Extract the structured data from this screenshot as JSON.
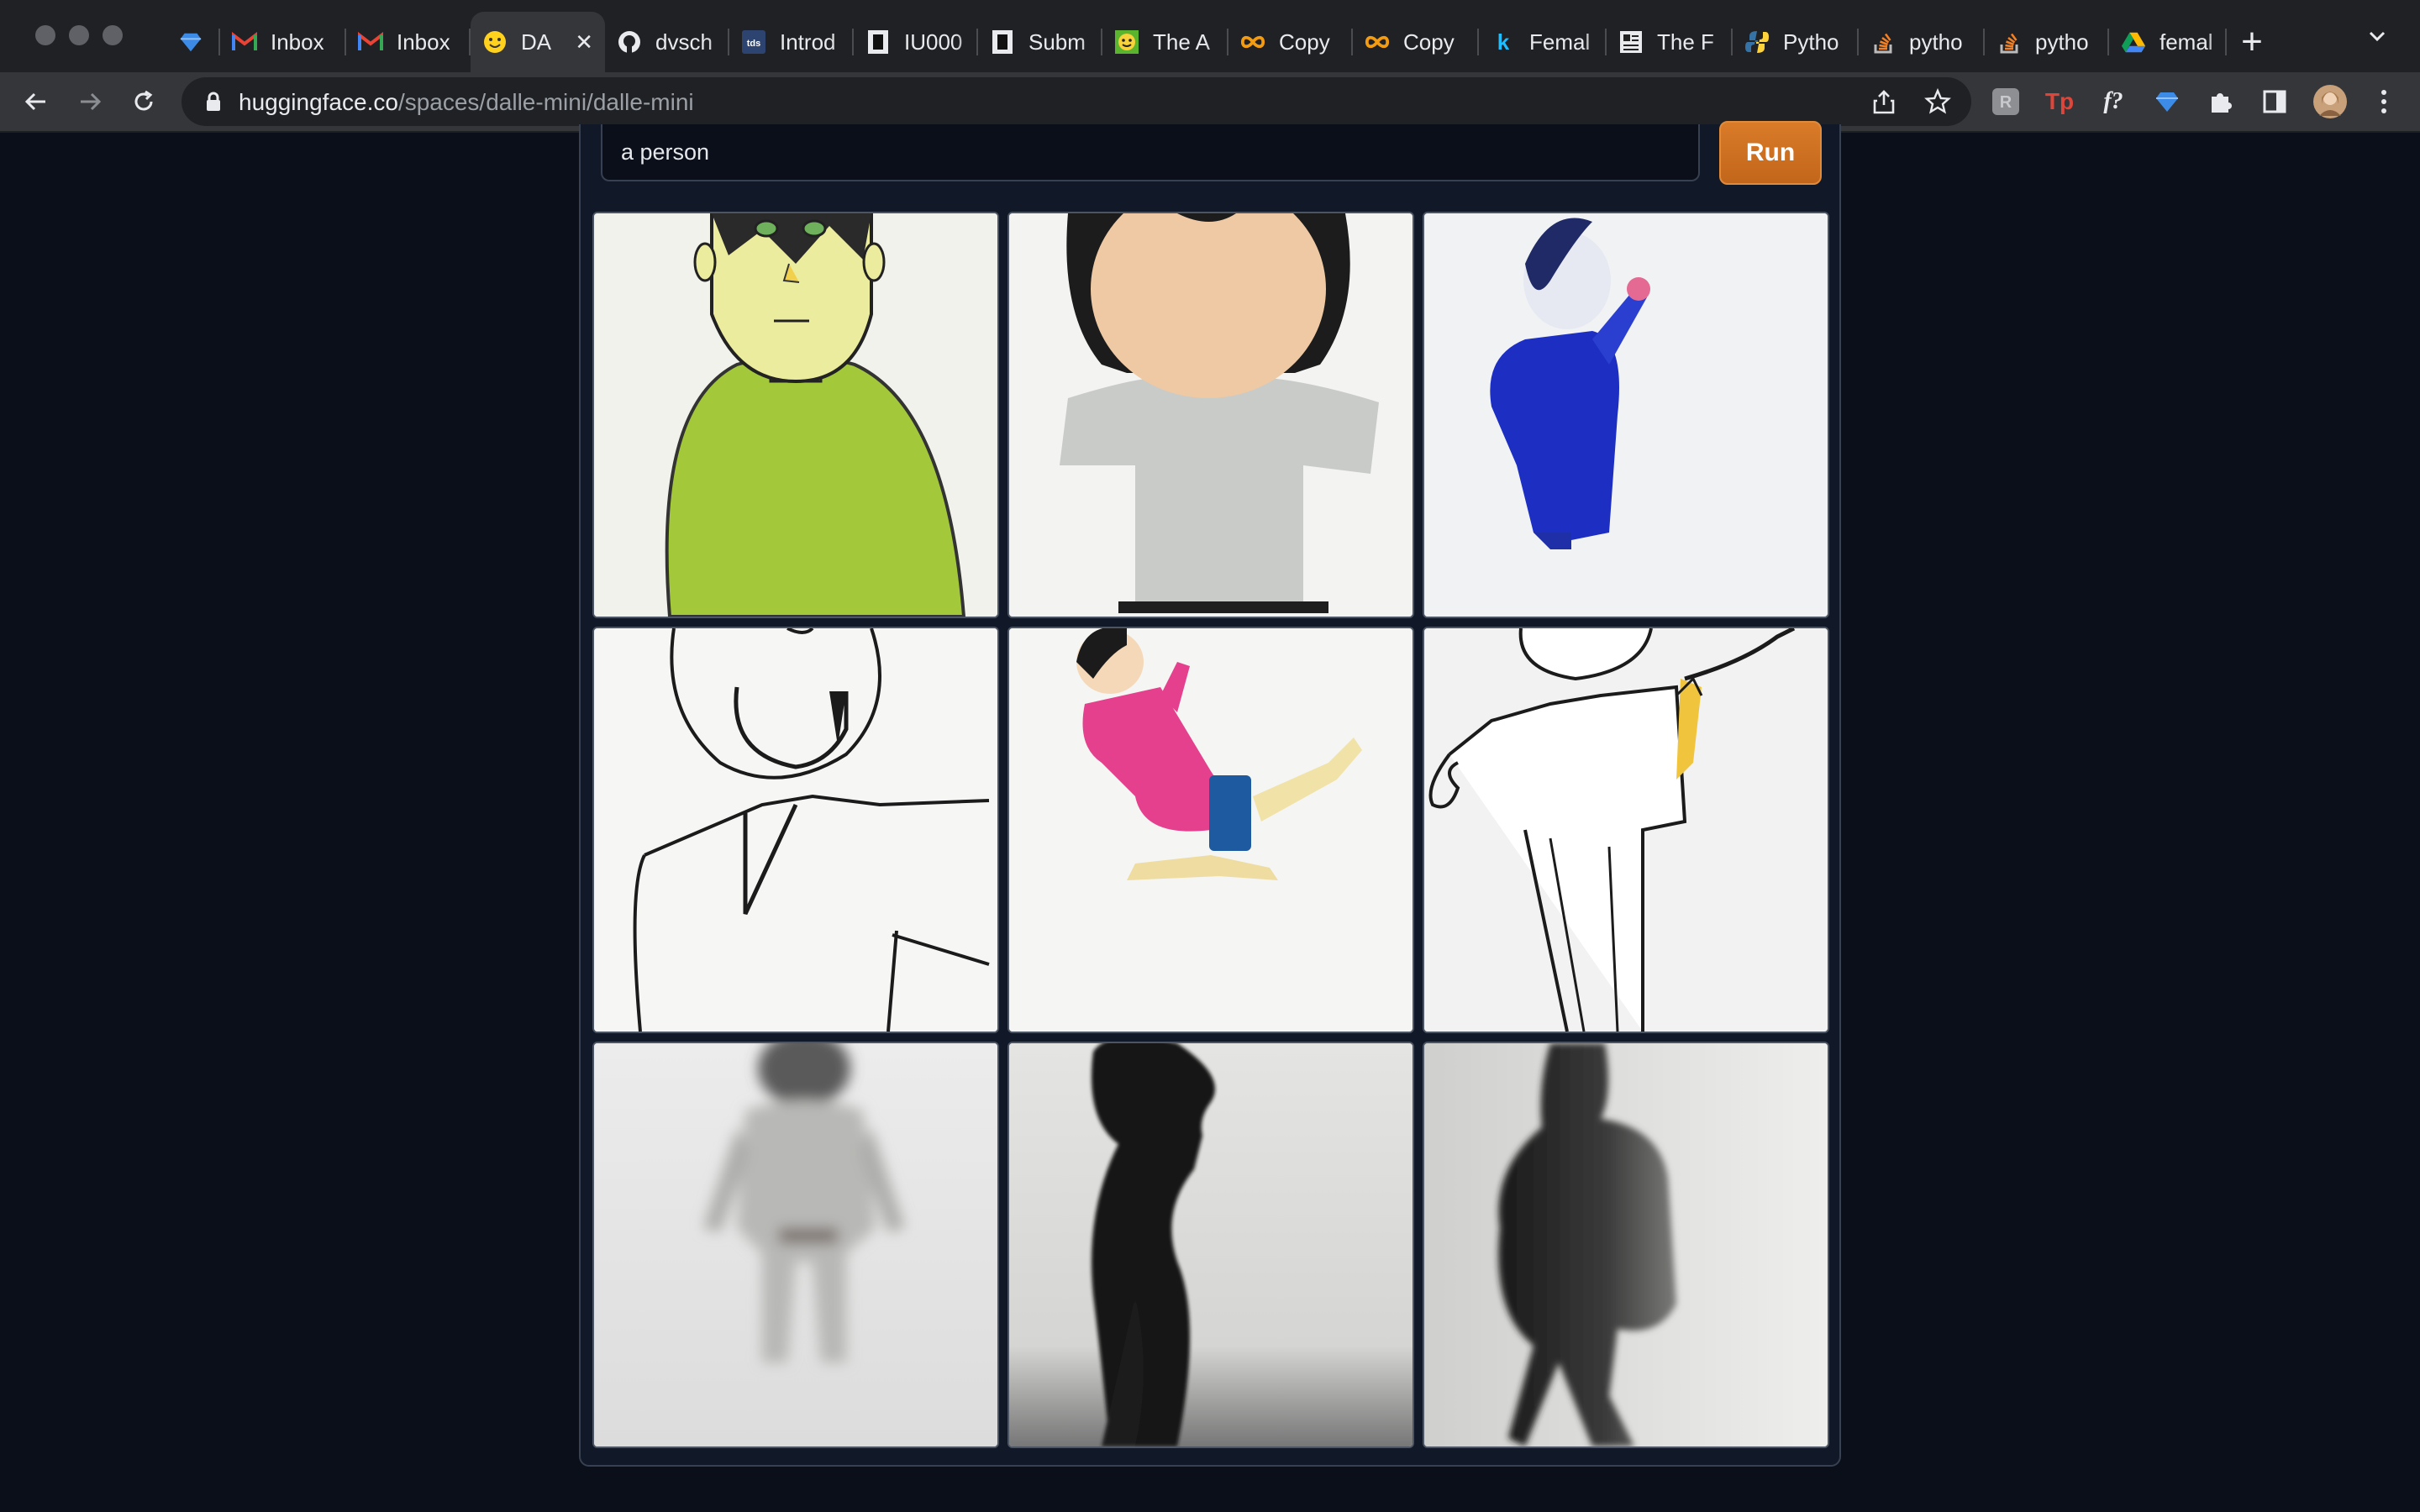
{
  "browser": {
    "tabs": [
      {
        "label": "",
        "icon": "gem-icon",
        "pinned": true
      },
      {
        "label": "Inbox",
        "icon": "gmail-icon"
      },
      {
        "label": "Inbox",
        "icon": "gmail-icon"
      },
      {
        "label": "DA",
        "icon": "hugging-face-icon",
        "active": true
      },
      {
        "label": "dvsch",
        "icon": "github-icon"
      },
      {
        "label": "Introd",
        "icon": "tds-icon"
      },
      {
        "label": "IU000",
        "icon": "notion-icon"
      },
      {
        "label": "Subm",
        "icon": "notion-icon"
      },
      {
        "label": "The A",
        "icon": "smiley-icon"
      },
      {
        "label": "Copy",
        "icon": "infinity-icon"
      },
      {
        "label": "Copy",
        "icon": "infinity-icon"
      },
      {
        "label": "Femal",
        "icon": "kaggle-icon"
      },
      {
        "label": "The F",
        "icon": "document-icon"
      },
      {
        "label": "Pytho",
        "icon": "python-icon"
      },
      {
        "label": "pytho",
        "icon": "stackoverflow-icon"
      },
      {
        "label": "pytho",
        "icon": "stackoverflow-icon"
      },
      {
        "label": "femal",
        "icon": "google-drive-icon"
      }
    ],
    "new_tab": "+",
    "address": {
      "host": "huggingface.co",
      "path": "/spaces/dalle-mini/dalle-mini"
    },
    "extensions": [
      "grammarly-icon",
      "tp-icon",
      "fx-icon",
      "gem-icon",
      "puzzle-icon",
      "side-panel-icon",
      "profile-avatar"
    ]
  },
  "app": {
    "prompt": {
      "value": "a person"
    },
    "run_label": "Run",
    "accent": "#c96a1f",
    "images": [
      "green-sweater-figure",
      "grey-shirt-figure",
      "blue-figure",
      "line-drawing-face",
      "pink-dancer",
      "line-drawing-figure",
      "blurry-grey-figure",
      "black-silhouette",
      "dark-silhouette"
    ]
  }
}
